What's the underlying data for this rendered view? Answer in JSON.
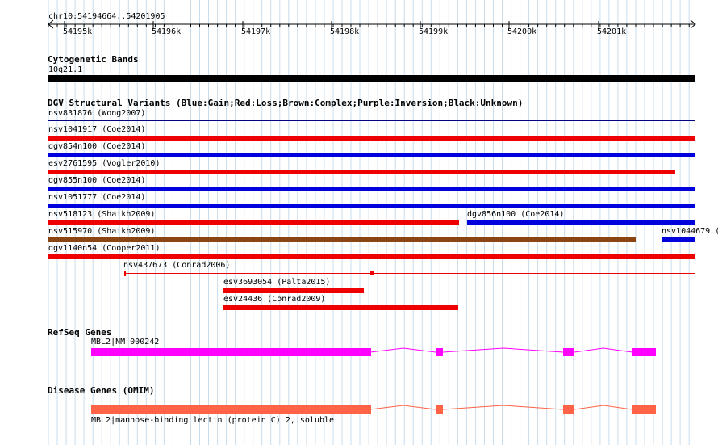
{
  "ruler": {
    "region": "chr10:54194664..54201905",
    "ticks": [
      "54195k",
      "54196k",
      "54197k",
      "54198k",
      "54199k",
      "54200k",
      "54201k"
    ]
  },
  "cytoband": {
    "title": "Cytogenetic Bands",
    "label": "10q21.1",
    "color": "#000000"
  },
  "dgv": {
    "title": "DGV Structural Variants (Blue:Gain;Red:Loss;Brown:Complex;Purple:Inversion;Black:Unknown)",
    "colors": {
      "gain": "#0000dd",
      "loss": "#ee0000",
      "complex": "#8b4513",
      "unknown": "#000080"
    },
    "variants": [
      {
        "label": "nsv831876 (Wong2007)",
        "type": "unknown"
      },
      {
        "label": "nsv1041917 (Coe2014)",
        "type": "loss"
      },
      {
        "label": "dgv854n100 (Coe2014)",
        "type": "gain"
      },
      {
        "label": "esv2761595 (Vogler2010)",
        "type": "loss"
      },
      {
        "label": "dgv855n100 (Coe2014)",
        "type": "gain"
      },
      {
        "label": "nsv1051777 (Coe2014)",
        "type": "gain"
      },
      {
        "label": "nsv518123 (Shaikh2009)",
        "type": "loss"
      },
      {
        "label": "dgv856n100 (Coe2014)",
        "type": "gain"
      },
      {
        "label": "nsv515970 (Shaikh2009)",
        "type": "complex"
      },
      {
        "label": "nsv1044679 (",
        "type": "gain"
      },
      {
        "label": "dgv1140n54 (Cooper2011)",
        "type": "loss"
      },
      {
        "label": "nsv437673 (Conrad2006)",
        "type": "loss"
      },
      {
        "label": "esv3693054 (Palta2015)",
        "type": "loss"
      },
      {
        "label": "esv24436 (Conrad2009)",
        "type": "loss"
      }
    ]
  },
  "refseq": {
    "title": "RefSeq Genes",
    "label": "MBL2|NM_000242",
    "color": "#ff00ff"
  },
  "omim": {
    "title": "Disease Genes (OMIM)",
    "label": "MBL2|mannose-binding lectin (protein C) 2, soluble",
    "color": "#ff6347"
  }
}
